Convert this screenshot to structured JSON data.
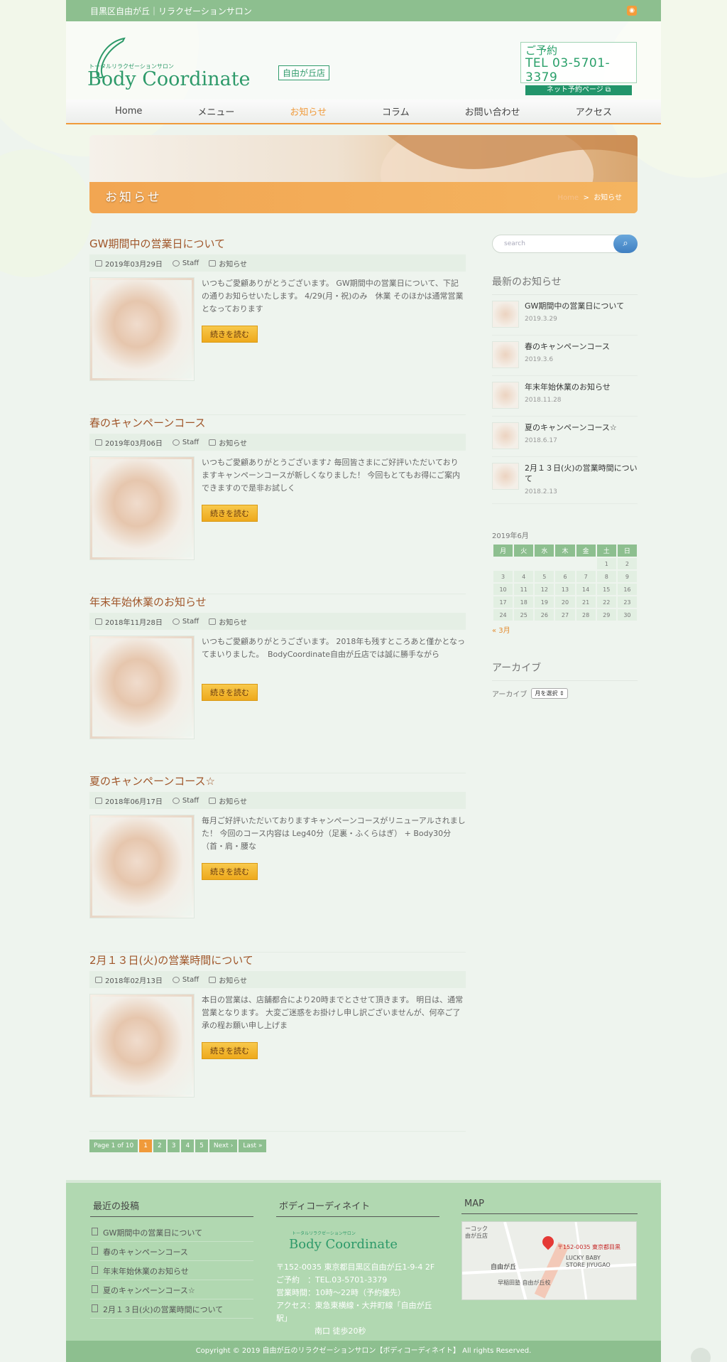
{
  "topbar": {
    "tagline": "目黒区自由が丘｜リラクゼーションサロン"
  },
  "logo": {
    "subtitle": "トータルリラクゼーションサロン",
    "name": "Body Coordinate",
    "badge": "自由が丘店"
  },
  "contact": {
    "label": "ご予約",
    "tel": "TEL 03-5701-3379",
    "net": "ネット予約ページ"
  },
  "nav": [
    "Home",
    "メニュー",
    "お知らせ",
    "コラム",
    "お問い合わせ",
    "アクセス"
  ],
  "nav_active": "お知らせ",
  "hero": {
    "title": "お知らせ",
    "crumb_home": "Home",
    "crumb_sep": ">",
    "crumb_current": "お知らせ"
  },
  "read_more": "続きを読む",
  "posts": [
    {
      "title": "GW期間中の営業日について",
      "date": "2019年03月29日",
      "author": "Staff",
      "category": "お知らせ",
      "excerpt": "いつもご愛顧ありがとうございます。 GW期間中の営業日について、下記の通りお知らせいたします。 4/29(月・祝)のみ　休業 そのほかは通常営業となっております"
    },
    {
      "title": "春のキャンペーンコース",
      "date": "2019年03月06日",
      "author": "Staff",
      "category": "お知らせ",
      "excerpt": "いつもご愛顧ありがとうございます♪ 毎回皆さまにご好評いただいておりますキャンペーンコースが新しくなりました！ 今回もとてもお得にご案内できますので是非お試しく"
    },
    {
      "title": "年末年始休業のお知らせ",
      "date": "2018年11月28日",
      "author": "Staff",
      "category": "お知らせ",
      "excerpt": "いつもご愛顧ありがとうございます。 2018年も残すところあと僅かとなってまいりました。　BodyCoordinate自由が丘店では誠に勝手ながら"
    },
    {
      "title": "夏のキャンペーンコース☆",
      "date": "2018年06月17日",
      "author": "Staff",
      "category": "お知らせ",
      "excerpt": "毎月ご好評いただいておりますキャンペーンコースがリニューアルされました！ 今回のコース内容は Leg40分（足裏・ふくらはぎ） + Body30分（首・肩・腰な"
    },
    {
      "title": "2月１３日(火)の営業時間について",
      "date": "2018年02月13日",
      "author": "Staff",
      "category": "お知らせ",
      "excerpt": "本日の営業は、店舗都合により20時までとさせて頂きます。 明日は、通常営業となります。 大変ご迷惑をお掛けし申し訳ございませんが、何卒ご了承の程お願い申し上げま"
    }
  ],
  "pager": [
    "Page 1 of 10",
    "1",
    "2",
    "3",
    "4",
    "5",
    "Next ›",
    "Last »"
  ],
  "pager_current": "1",
  "search": {
    "placeholder": "search",
    "icon": "search-icon"
  },
  "recent": {
    "title": "最新のお知らせ",
    "items": [
      {
        "title": "GW期間中の営業日について",
        "date": "2019.3.29"
      },
      {
        "title": "春のキャンペーンコース",
        "date": "2019.3.6"
      },
      {
        "title": "年末年始休業のお知らせ",
        "date": "2018.11.28"
      },
      {
        "title": "夏のキャンペーンコース☆",
        "date": "2018.6.17"
      },
      {
        "title": "2月１３日(火)の営業時間について",
        "date": "2018.2.13"
      }
    ]
  },
  "calendar": {
    "caption": "2019年6月",
    "headers": [
      "月",
      "火",
      "水",
      "木",
      "金",
      "土",
      "日"
    ],
    "weeks": [
      [
        "",
        "",
        "",
        "",
        "",
        "1",
        "2"
      ],
      [
        "3",
        "4",
        "5",
        "6",
        "7",
        "8",
        "9"
      ],
      [
        "10",
        "11",
        "12",
        "13",
        "14",
        "15",
        "16"
      ],
      [
        "17",
        "18",
        "19",
        "20",
        "21",
        "22",
        "23"
      ],
      [
        "24",
        "25",
        "26",
        "27",
        "28",
        "29",
        "30"
      ]
    ],
    "prev": "« 3月"
  },
  "archive": {
    "title": "アーカイブ",
    "label": "アーカイブ",
    "select": "月を選択"
  },
  "footer": {
    "recent_title": "最近の投稿",
    "recent_items": [
      "GW期間中の営業日について",
      "春のキャンペーンコース",
      "年末年始休業のお知らせ",
      "夏のキャンペーンコース☆",
      "2月１３日(火)の営業時間について"
    ],
    "company_title": "ボディコーディネイト",
    "logo_sub": "トータルリラクゼーションサロン",
    "logo_name": "Body Coordinate",
    "address": "〒152-0035 東京都目黒区自由が丘1-9-4 2F",
    "tel": "ご予約　：TEL.03-5701-3379",
    "hours": "営業時間：10時〜22時（予約優先）",
    "access1": "アクセス：東急東横線・大井町線「自由が丘駅」",
    "access2": "南口 徒歩20秒",
    "map_title": "MAP",
    "map_labels": [
      "ーコック",
      "由が丘店",
      "〒152-0035 東京都目黒",
      "自由が丘",
      "LUCKY BABY",
      "STORE JIYUGAO",
      "早稲田塾 自由が丘校"
    ]
  },
  "copyright": "Copyright © 2019 自由が丘のリラクゼーションサロン【ボディコーディネイト】 All rights Reserved.",
  "colors": {
    "green": "#8dbf8f",
    "orange": "#f09a3a",
    "title_brown": "#a0562a"
  }
}
